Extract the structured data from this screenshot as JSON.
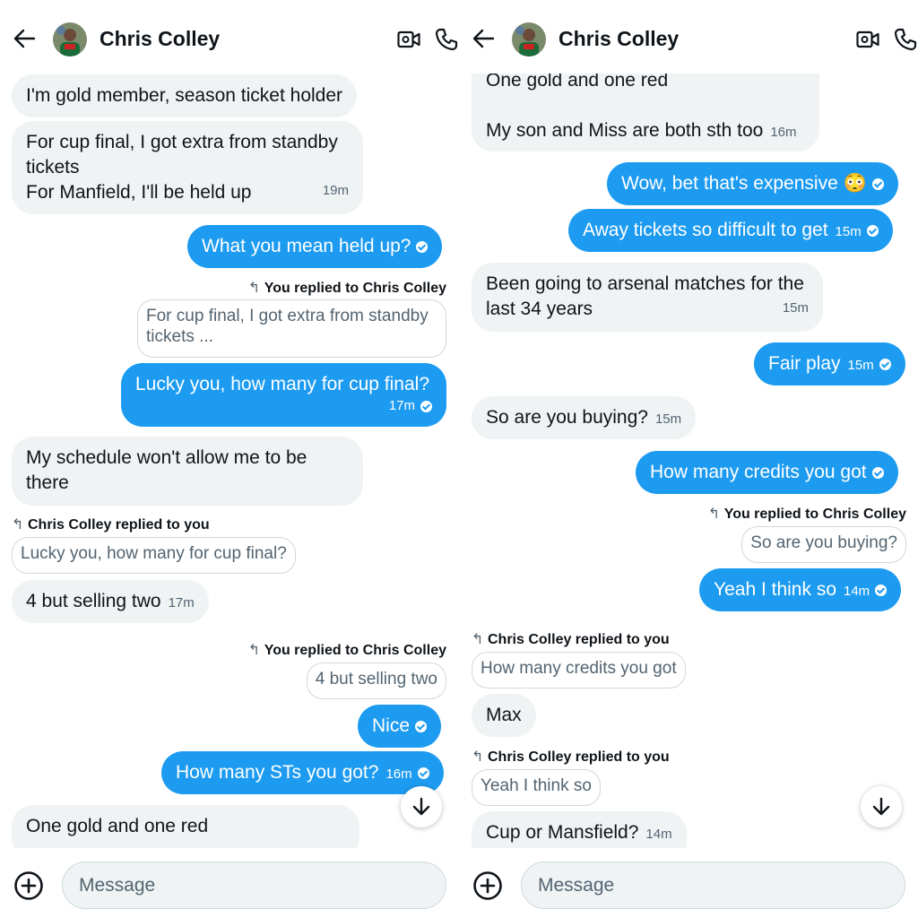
{
  "left": {
    "contact_name": "Chris Colley",
    "messages": [
      {
        "text": "I'm gold member, season ticket holder"
      },
      {
        "line1": "For cup final, I got extra from standby",
        "line2": "tickets",
        "line3": "For Manfield, I'll be held up",
        "time": "19m"
      },
      {
        "text": "What you mean held up?"
      },
      {
        "reply_label": "You replied to Chris Colley",
        "quote_line1": "For cup final, I got extra from standby",
        "quote_line2": "tickets ..."
      },
      {
        "text": "Lucky you, how many for cup final?",
        "time": "17m"
      },
      {
        "line1": "My schedule won't allow me to be",
        "line2": "there"
      },
      {
        "reply_label": "Chris Colley replied to you",
        "quote": "Lucky you, how many for cup final?"
      },
      {
        "text": "4 but selling two",
        "time": "17m"
      },
      {
        "reply_label": "You replied to Chris Colley",
        "quote": "4 but selling two"
      },
      {
        "text": "Nice"
      },
      {
        "text": "How many STs you got?",
        "time": "16m"
      },
      {
        "text": "One gold and one red"
      }
    ],
    "input_placeholder": "Message"
  },
  "right": {
    "contact_name": "Chris Colley",
    "messages": [
      {
        "line1": "One gold and one red",
        "line2": "My son and Miss are both sth too",
        "time": "16m"
      },
      {
        "text": "Wow, bet that's expensive 😳"
      },
      {
        "text": "Away tickets so difficult to get",
        "time": "15m"
      },
      {
        "line1": "Been going to arsenal matches for the",
        "line2": "last 34 years",
        "time": "15m"
      },
      {
        "text": "Fair play",
        "time": "15m"
      },
      {
        "text": "So are you buying?",
        "time": "15m"
      },
      {
        "text": "How many credits you got"
      },
      {
        "reply_label": "You replied to Chris Colley",
        "quote": "So are you buying?"
      },
      {
        "text": "Yeah I think so",
        "time": "14m"
      },
      {
        "reply_label": "Chris Colley replied to you",
        "quote": "How many credits you got"
      },
      {
        "text": "Max"
      },
      {
        "reply_label": "Chris Colley replied to you",
        "quote": "Yeah I think so"
      },
      {
        "text": "Cup or Mansfield?",
        "time": "14m"
      }
    ],
    "input_placeholder": "Message"
  },
  "icons": {
    "back": "arrow-left-icon",
    "video": "video-camera-icon",
    "phone": "phone-icon",
    "add": "plus-circle-icon",
    "scroll": "arrow-down-icon",
    "reply": "reply-arrow-icon"
  },
  "colors": {
    "outgoing_bubble": "#1d9bf0",
    "incoming_bubble": "#eff3f4",
    "text": "#0f1419",
    "muted": "#536471",
    "border": "#cfd9de"
  }
}
